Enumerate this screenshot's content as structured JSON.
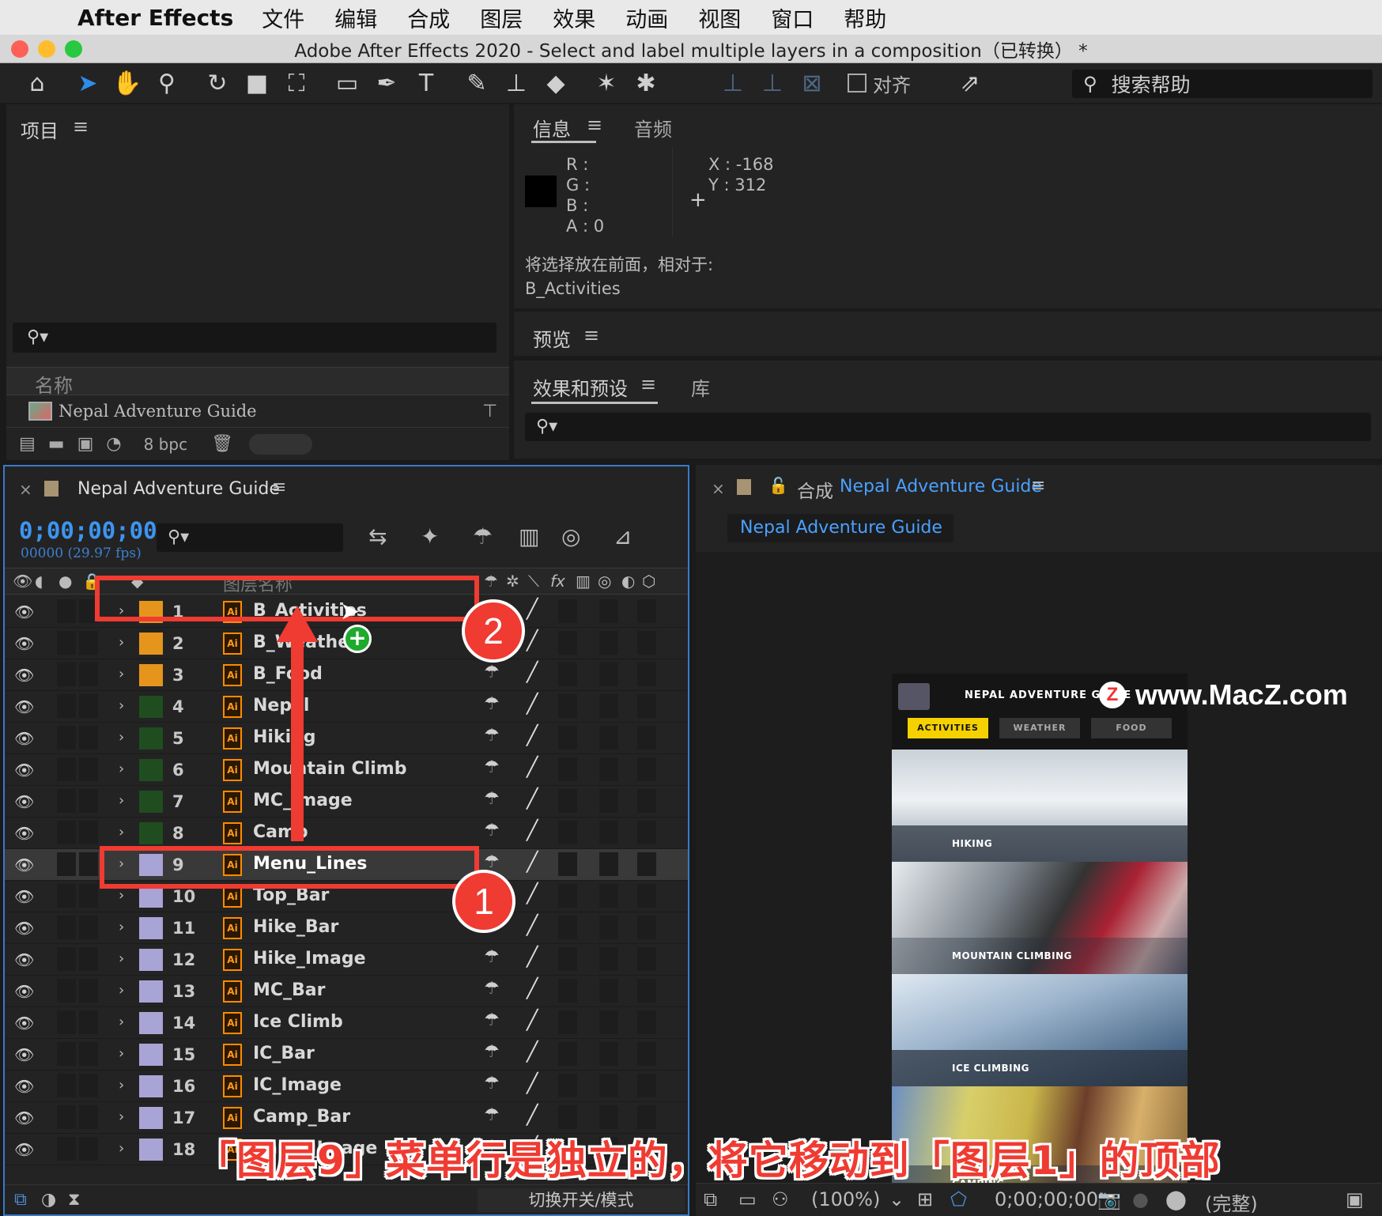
{
  "menubar": {
    "app": "After Effects",
    "items": [
      "文件",
      "编辑",
      "合成",
      "图层",
      "效果",
      "动画",
      "视图",
      "窗口",
      "帮助"
    ]
  },
  "window": {
    "title": "Adobe After Effects 2020 - Select and label multiple layers in a composition（已转换） *"
  },
  "toolbar": {
    "tools": [
      "home-icon",
      "selection-tool-icon",
      "hand-tool-icon",
      "zoom-tool-icon",
      "rotate-tool-icon",
      "camera-tool-icon",
      "pan-behind-icon",
      "rectangle-tool-icon",
      "pen-tool-icon",
      "type-tool-icon",
      "brush-tool-icon",
      "clone-stamp-icon",
      "eraser-tool-icon",
      "roto-brush-icon",
      "puppet-pin-icon"
    ],
    "align_label": "对齐",
    "search_help": "搜索帮助"
  },
  "project": {
    "tab": "项目",
    "column_name": "名称",
    "item": "Nepal Adventure Guide",
    "bpc": "8 bpc"
  },
  "info": {
    "tab": "信息",
    "tab2": "音频",
    "r": "R :",
    "g": "G :",
    "b": "B :",
    "a": "A :  0",
    "x": "X : -168",
    "y": "Y : 312",
    "status_line1": "将选择放在前面，相对于:",
    "status_line2": "B_Activities",
    "swatch_color": "#000000"
  },
  "preview": {
    "tab": "预览"
  },
  "effects": {
    "tab": "效果和预设",
    "tab2": "库"
  },
  "timeline": {
    "title": "Nepal Adventure Guide",
    "timecode": "0;00;00;00",
    "frames": "00000 (29.97 fps)",
    "col_layername": "图层名称",
    "toggle_modes": "切换开关/模式",
    "layers": [
      {
        "num": "1",
        "name": "B_Activities",
        "color": "#e6951c"
      },
      {
        "num": "2",
        "name": "B_Weather",
        "color": "#e6951c"
      },
      {
        "num": "3",
        "name": "B_Food",
        "color": "#e6951c"
      },
      {
        "num": "4",
        "name": "Nepal",
        "color": "#1f4d1f"
      },
      {
        "num": "5",
        "name": "Hiking",
        "color": "#1f4d1f"
      },
      {
        "num": "6",
        "name": "Mountain Climb",
        "color": "#1f4d1f"
      },
      {
        "num": "7",
        "name": "MC_Image",
        "color": "#1f4d1f"
      },
      {
        "num": "8",
        "name": "Camp",
        "color": "#1f4d1f"
      },
      {
        "num": "9",
        "name": "Menu_Lines",
        "color": "#a9a4d6"
      },
      {
        "num": "10",
        "name": "Top_Bar",
        "color": "#a9a4d6"
      },
      {
        "num": "11",
        "name": "Hike_Bar",
        "color": "#a9a4d6"
      },
      {
        "num": "12",
        "name": "Hike_Image",
        "color": "#a9a4d6"
      },
      {
        "num": "13",
        "name": "MC_Bar",
        "color": "#a9a4d6"
      },
      {
        "num": "14",
        "name": "Ice Climb",
        "color": "#a9a4d6"
      },
      {
        "num": "15",
        "name": "IC_Bar",
        "color": "#a9a4d6"
      },
      {
        "num": "16",
        "name": "IC_Image",
        "color": "#a9a4d6"
      },
      {
        "num": "17",
        "name": "Camp_Bar",
        "color": "#a9a4d6"
      },
      {
        "num": "18",
        "name": "Camp_Image",
        "color": "#a9a4d6"
      }
    ]
  },
  "viewer": {
    "prefix": "合成",
    "title": "Nepal Adventure Guide",
    "tab": "Nepal Adventure Guide",
    "zoom": "(100%)",
    "timecode": "0;00;00;00",
    "quality": "(完整)"
  },
  "mockup": {
    "title": "NEPAL ADVENTURE GUIDE",
    "tabs": [
      "ACTIVITIES",
      "WEATHER",
      "FOOD"
    ],
    "sections": [
      "HIKING",
      "MOUNTAIN CLIMBING",
      "ICE CLIMBING",
      "CAMPING"
    ]
  },
  "annotations": {
    "watermark": "www.MacZ.com",
    "badge1": "1",
    "badge2": "2",
    "caption": "「图层9」菜单行是独立的，将它移动到「图层1」的顶部"
  }
}
